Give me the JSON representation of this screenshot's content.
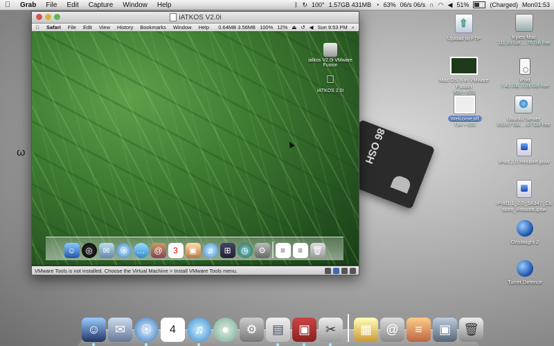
{
  "host_menubar": {
    "app": "Grab",
    "menus": [
      "File",
      "Edit",
      "Capture",
      "Window",
      "Help"
    ],
    "status": {
      "percent1": "100°",
      "net": "1.57GB 431MB",
      "cpu": "63%",
      "disk": "06/s 06/s",
      "battery": "51%",
      "battery_state": "(Charged)",
      "clock": "Mon01:53"
    }
  },
  "vm": {
    "title": "iATKOS V2.0i",
    "guest_menubar": {
      "app": "Safari",
      "menus": [
        "File",
        "Edit",
        "View",
        "History",
        "Bookmarks",
        "Window",
        "Help"
      ],
      "status": {
        "net": "0.64MB 3.56MB",
        "zoom": "100%",
        "percent": "12%",
        "clock": "Sun 9:53 PM"
      }
    },
    "guest_icons": [
      {
        "label": "iatkos V2.0i VMware Fusion"
      },
      {
        "label": "iATKOS 2.0i"
      }
    ],
    "guest_dock": [
      "Finder",
      "Dashboard",
      "Mail",
      "Safari",
      "iChat",
      "Address Book",
      "iCal",
      "iPhoto",
      "iTunes",
      "Spaces",
      "Time Machine",
      "System Preferences",
      "Document",
      "Document",
      "Trash"
    ],
    "status_text": "VMware Tools is not installed. Choose the Virtual Machine > Install VMware Tools menu."
  },
  "desktop": {
    "background_text": "86\nOSH",
    "icons": [
      {
        "label": "Upload to FTP",
        "sub": ""
      },
      {
        "label": "Kyles-Mac",
        "sub": "111.35 GB, ...76 GB free"
      },
      {
        "label": "Mac OS X in VMware Fusion",
        "sub": "959 × 679"
      },
      {
        "label": "iPod",
        "sub": "7.41 GB, 5.01 GB free"
      },
      {
        "label": "Welcome.tiff",
        "sub": "714 × 633"
      },
      {
        "label": "Ubuntu Server",
        "sub": "953.67 GB, ...67 GB free"
      },
      {
        "label": "iPod 2.0 Restore.ipsw",
        "sub": ""
      },
      {
        "label": "iPod1,1_2.0_5A347_Custom_Restore.ipsw",
        "sub": ""
      },
      {
        "label": "Onslaught 2",
        "sub": ""
      },
      {
        "label": "Turret Defence",
        "sub": ""
      }
    ]
  },
  "host_dock": {
    "items": [
      "Finder",
      "Mail",
      "Safari",
      "iCal",
      "iTunes",
      "Growl",
      "System Preferences",
      "Preview",
      "VMware Fusion",
      "Grab",
      "Applications",
      "Downloads",
      "Documents",
      "Pictures",
      "Trash"
    ],
    "ical_day": "4"
  }
}
